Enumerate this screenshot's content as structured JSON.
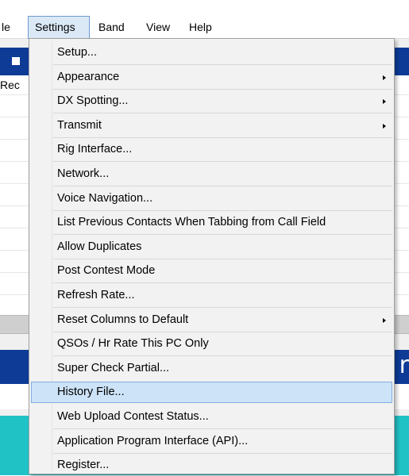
{
  "menubar": {
    "file": "le",
    "settings": "Settings",
    "band": "Band",
    "view": "View",
    "help": "Help"
  },
  "background": {
    "grid_header": "Rec",
    "mid_bar_char": "r"
  },
  "settings_menu": {
    "items": [
      {
        "label": "Setup...",
        "submenu": false
      },
      {
        "label": "Appearance",
        "submenu": true
      },
      {
        "label": "DX Spotting...",
        "submenu": true
      },
      {
        "label": "Transmit",
        "submenu": true
      },
      {
        "label": "Rig Interface...",
        "submenu": false
      },
      {
        "label": "Network...",
        "submenu": false
      },
      {
        "label": "Voice Navigation...",
        "submenu": false
      },
      {
        "label": "List Previous Contacts When Tabbing from Call Field",
        "submenu": false
      },
      {
        "label": "Allow Duplicates",
        "submenu": false
      },
      {
        "label": "Post Contest Mode",
        "submenu": false
      },
      {
        "label": "Refresh Rate...",
        "submenu": false
      },
      {
        "label": "Reset Columns to Default",
        "submenu": true
      },
      {
        "label": "QSOs / Hr Rate This PC Only",
        "submenu": false
      },
      {
        "label": "Super Check Partial...",
        "submenu": false
      },
      {
        "label": "History File...",
        "submenu": false,
        "highlighted": true
      },
      {
        "label": "Web Upload Contest Status...",
        "submenu": false
      },
      {
        "label": "Application Program Interface (API)...",
        "submenu": false
      },
      {
        "label": "Register...",
        "submenu": false
      }
    ]
  },
  "colors": {
    "blue_bar": "#0d3b96",
    "teal_bar": "#21c2c5",
    "highlight": "#cde3f7"
  }
}
